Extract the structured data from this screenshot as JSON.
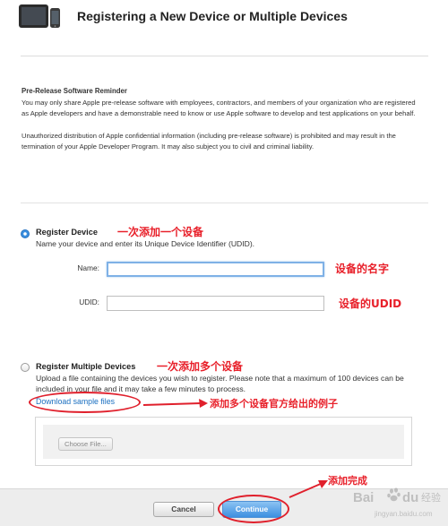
{
  "header": {
    "title": "Registering a New Device or Multiple Devices",
    "icon": "ipad-iphone-devices-icon"
  },
  "reminder": {
    "title": "Pre-Release Software Reminder",
    "paragraph1": "You may only share Apple pre-release software with employees, contractors, and members of your organization who are registered as Apple developers and have a demonstrable need to know or use Apple software to develop and test applications on your behalf.",
    "paragraph2": "Unauthorized distribution of Apple confidential information (including pre-release software) is prohibited and may result in the termination of your Apple Developer Program. It may also subject you to civil and criminal liability."
  },
  "register_device": {
    "label": "Register Device",
    "selected": true,
    "description": "Name your device and enter its Unique Device Identifier (UDID).",
    "name_label": "Name:",
    "name_value": "",
    "udid_label": "UDID:",
    "udid_value": ""
  },
  "register_multiple": {
    "label": "Register Multiple Devices",
    "selected": false,
    "description": "Upload a file containing the devices you wish to register. Please note that a maximum of 100 devices can be included in your file and it may take a few minutes to process.",
    "download_link": "Download sample files",
    "choose_file_label": "Choose File..."
  },
  "footer": {
    "cancel_label": "Cancel",
    "continue_label": "Continue"
  },
  "annotations": {
    "add_one": "一次添加一个设备",
    "device_name": "设备的名字",
    "device_udid": "设备的UDID",
    "add_multiple": "一次添加多个设备",
    "sample_files": "添加多个设备官方给出的例子",
    "done": "添加完成",
    "color": "#e8202a"
  },
  "watermark": {
    "text": "Bai du 经验",
    "url": "jingyan.baidu.com"
  },
  "colors": {
    "link": "#1a6fc0",
    "primary_button": "#3d8fe0",
    "footer_bg": "#ededed"
  }
}
